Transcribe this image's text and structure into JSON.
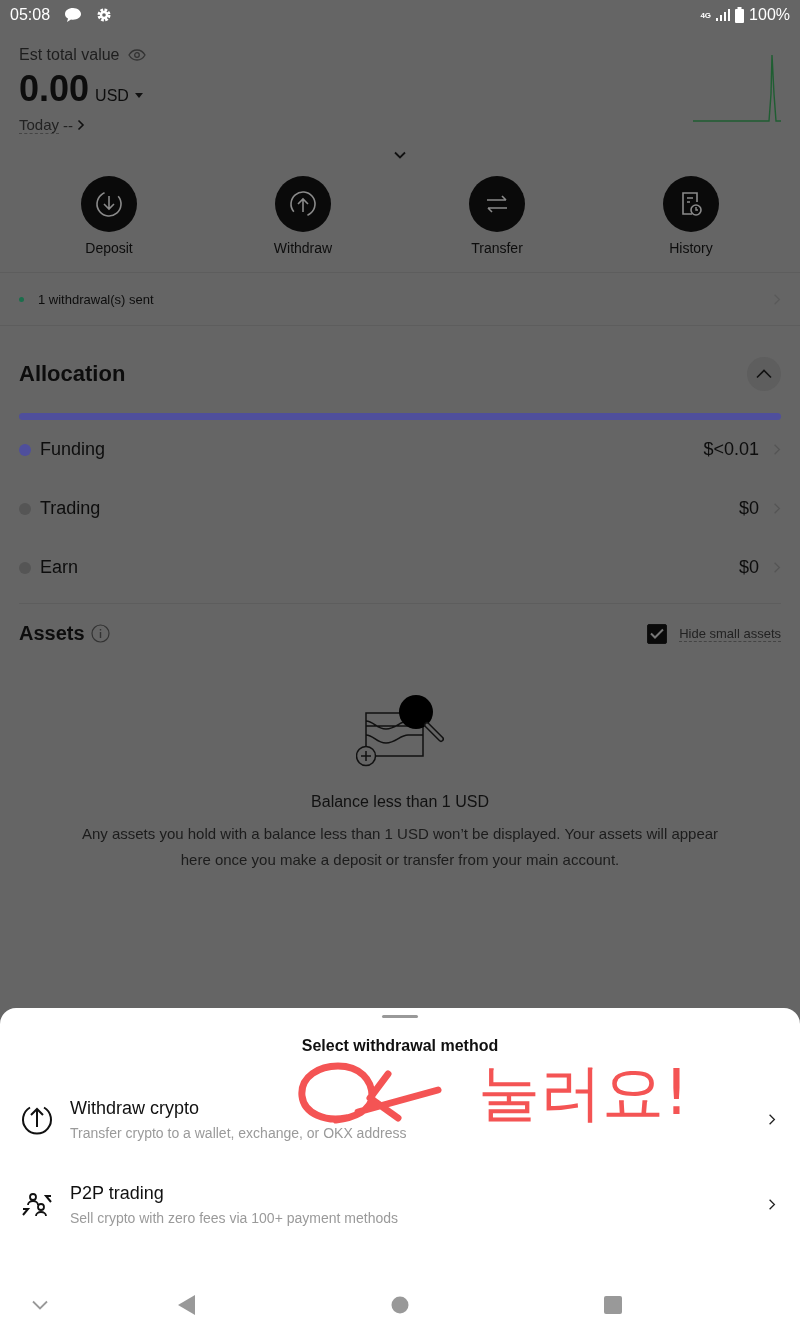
{
  "status_bar": {
    "time": "05:08",
    "network": "4G",
    "battery": "100%"
  },
  "balance": {
    "label": "Est total value",
    "amount": "0.00",
    "currency": "USD",
    "period": "Today",
    "change": "--"
  },
  "actions": [
    {
      "kind": "deposit",
      "label": "Deposit"
    },
    {
      "kind": "withdraw",
      "label": "Withdraw"
    },
    {
      "kind": "transfer",
      "label": "Transfer"
    },
    {
      "kind": "history",
      "label": "History"
    }
  ],
  "notice": {
    "text": "1 withdrawal(s) sent"
  },
  "allocation": {
    "title": "Allocation",
    "expanded": true,
    "accounts": [
      {
        "name": "Funding",
        "value": "$<0.01",
        "color": "#4f4f9c"
      },
      {
        "name": "Trading",
        "value": "$0",
        "color": "#555555"
      },
      {
        "name": "Earn",
        "value": "$0",
        "color": "#555555"
      }
    ]
  },
  "assets": {
    "title": "Assets",
    "hide_small": {
      "label": "Hide small assets",
      "checked": true
    },
    "empty_title": "Balance less than 1 USD",
    "empty_text": "Any assets you hold with a balance less than 1 USD won’t be displayed. Your assets will appear here once you make a deposit or transfer from your main account."
  },
  "sheet": {
    "title": "Select withdrawal method",
    "options": [
      {
        "kind": "crypto",
        "title": "Withdraw crypto",
        "subtitle": "Transfer crypto to a wallet, exchange, or OKX address"
      },
      {
        "kind": "p2p",
        "title": "P2P trading",
        "subtitle": "Sell crypto with zero fees via 100+ payment methods"
      }
    ]
  },
  "annotation": {
    "text": "눌러요!"
  }
}
